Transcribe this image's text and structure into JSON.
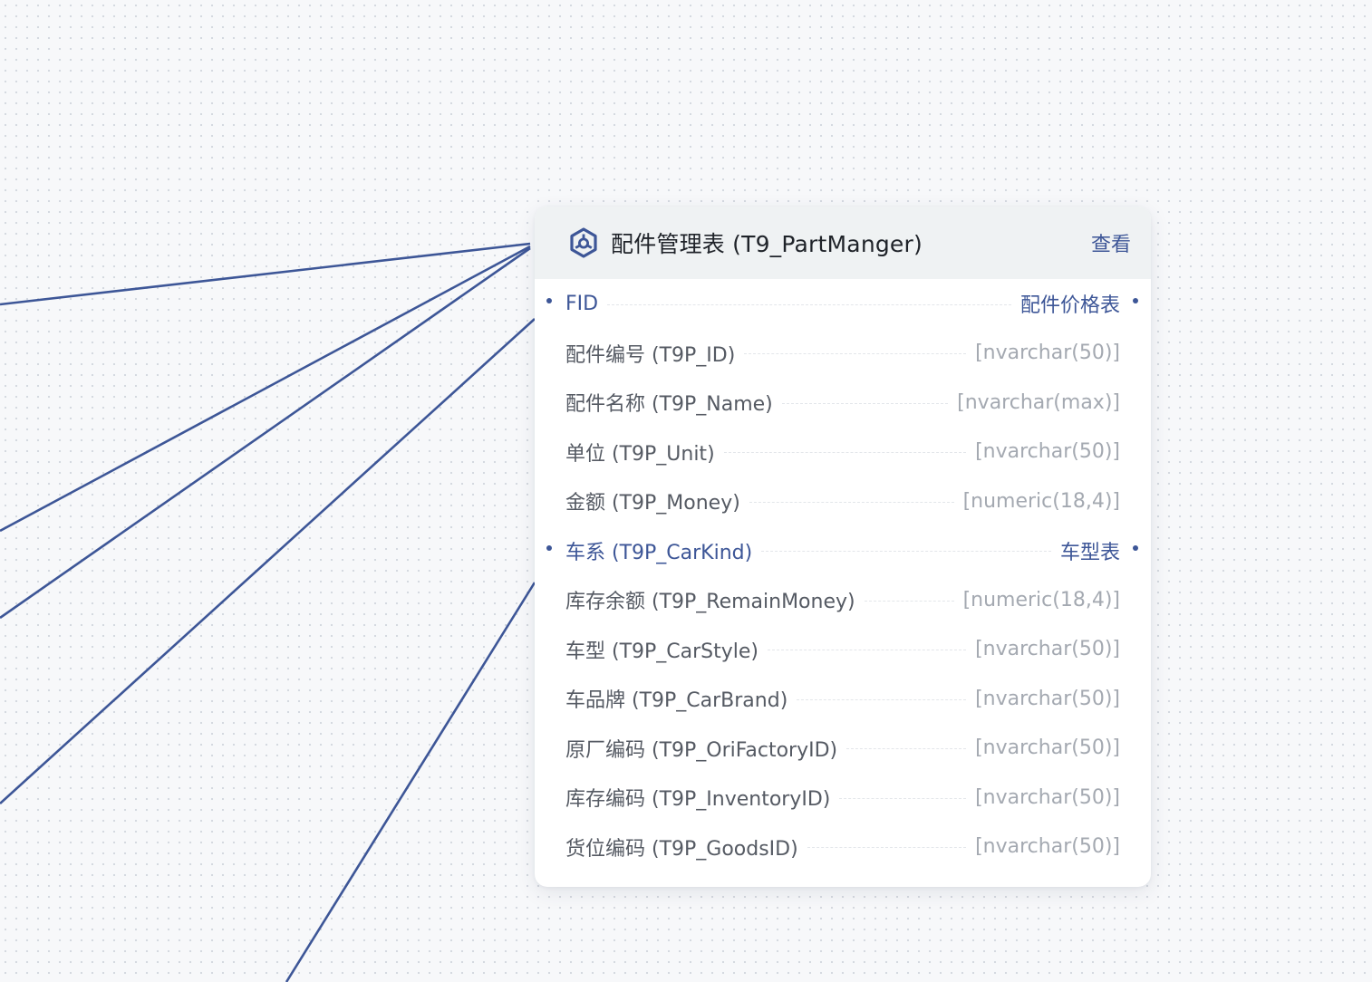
{
  "canvas": {
    "background": "#f7f8fa",
    "edge_color": "#3d5697"
  },
  "table": {
    "icon": "table-hexagon-icon",
    "title": "配件管理表 (T9_PartManger)",
    "view_label": "查看",
    "accent_color": "#3d5697",
    "fields": [
      {
        "name": "FID",
        "type": "配件价格表",
        "is_fk": true
      },
      {
        "name": "配件编号 (T9P_ID)",
        "type": "[nvarchar(50)]",
        "is_fk": false
      },
      {
        "name": "配件名称 (T9P_Name)",
        "type": "[nvarchar(max)]",
        "is_fk": false
      },
      {
        "name": "单位 (T9P_Unit)",
        "type": "[nvarchar(50)]",
        "is_fk": false
      },
      {
        "name": "金额 (T9P_Money)",
        "type": "[numeric(18,4)]",
        "is_fk": false
      },
      {
        "name": "车系 (T9P_CarKind)",
        "type": "车型表",
        "is_fk": true
      },
      {
        "name": "库存余额 (T9P_RemainMoney)",
        "type": "[numeric(18,4)]",
        "is_fk": false
      },
      {
        "name": "车型 (T9P_CarStyle)",
        "type": "[nvarchar(50)]",
        "is_fk": false
      },
      {
        "name": "车品牌 (T9P_CarBrand)",
        "type": "[nvarchar(50)]",
        "is_fk": false
      },
      {
        "name": "原厂编码 (T9P_OriFactoryID)",
        "type": "[nvarchar(50)]",
        "is_fk": false
      },
      {
        "name": "库存编码 (T9P_InventoryID)",
        "type": "[nvarchar(50)]",
        "is_fk": false
      },
      {
        "name": "货位编码 (T9P_GoodsID)",
        "type": "[nvarchar(50)]",
        "is_fk": false
      }
    ]
  }
}
